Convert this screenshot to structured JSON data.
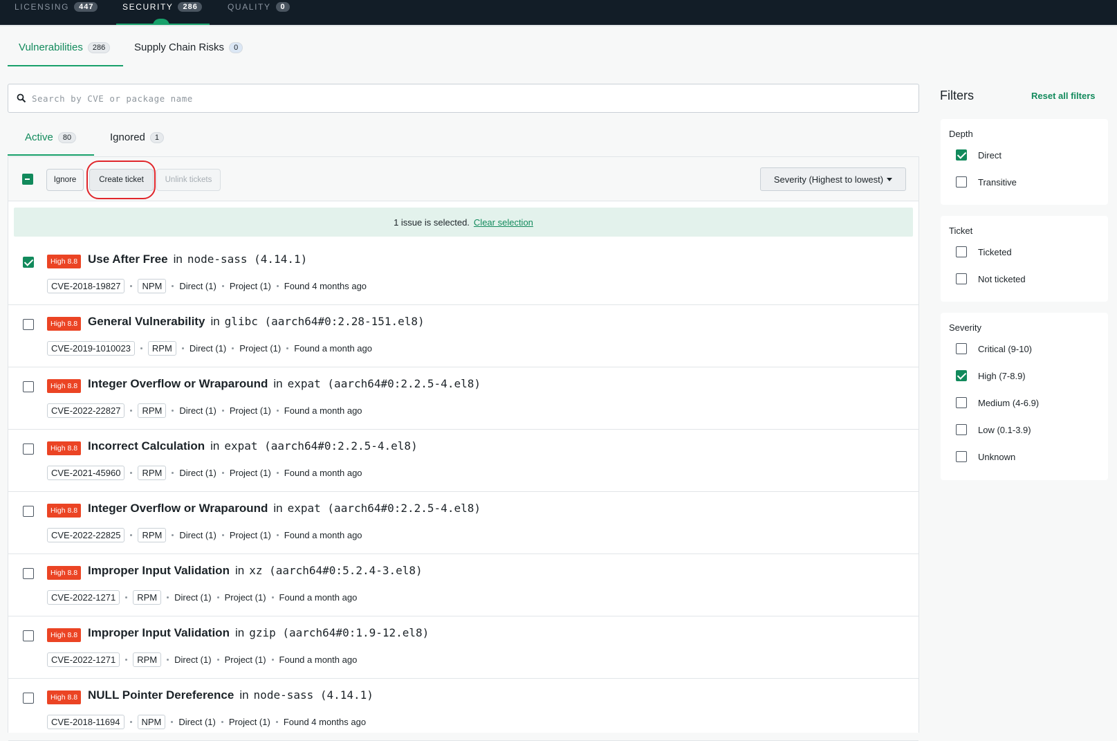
{
  "topnav": [
    {
      "label": "LICENSING",
      "count": "447",
      "active": false
    },
    {
      "label": "SECURITY",
      "count": "286",
      "active": true
    },
    {
      "label": "QUALITY",
      "count": "0",
      "active": false
    }
  ],
  "subtabs": [
    {
      "label": "Vulnerabilities",
      "count": "286",
      "active": true
    },
    {
      "label": "Supply Chain Risks",
      "count": "0",
      "active": false
    }
  ],
  "search": {
    "placeholder": "Search by CVE or package name",
    "value": ""
  },
  "state_tabs": [
    {
      "label": "Active",
      "count": "80",
      "active": true
    },
    {
      "label": "Ignored",
      "count": "1",
      "active": false
    }
  ],
  "toolbar": {
    "ignore_label": "Ignore",
    "create_ticket_label": "Create ticket",
    "unlink_tickets_label": "Unlink tickets",
    "sort_label": "Severity (Highest to lowest)"
  },
  "banner": {
    "text": "1 issue is selected.",
    "link": "Clear selection"
  },
  "vulnerabilities": [
    {
      "severity": "High 8.8",
      "title": "Use After Free",
      "in": "in",
      "package": "node-sass (4.14.1)",
      "cve": "CVE-2018-19827",
      "ecosystem": "NPM",
      "depth": "Direct (1)",
      "project": "Project (1)",
      "found": "Found 4 months ago",
      "checked": true
    },
    {
      "severity": "High 8.8",
      "title": "General Vulnerability",
      "in": "in",
      "package": "glibc (aarch64#0:2.28-151.el8)",
      "cve": "CVE-2019-1010023",
      "ecosystem": "RPM",
      "depth": "Direct (1)",
      "project": "Project (1)",
      "found": "Found a month ago",
      "checked": false
    },
    {
      "severity": "High 8.8",
      "title": "Integer Overflow or Wraparound",
      "in": "in",
      "package": "expat (aarch64#0:2.2.5-4.el8)",
      "cve": "CVE-2022-22827",
      "ecosystem": "RPM",
      "depth": "Direct (1)",
      "project": "Project (1)",
      "found": "Found a month ago",
      "checked": false
    },
    {
      "severity": "High 8.8",
      "title": "Incorrect Calculation",
      "in": "in",
      "package": "expat (aarch64#0:2.2.5-4.el8)",
      "cve": "CVE-2021-45960",
      "ecosystem": "RPM",
      "depth": "Direct (1)",
      "project": "Project (1)",
      "found": "Found a month ago",
      "checked": false
    },
    {
      "severity": "High 8.8",
      "title": "Integer Overflow or Wraparound",
      "in": "in",
      "package": "expat (aarch64#0:2.2.5-4.el8)",
      "cve": "CVE-2022-22825",
      "ecosystem": "RPM",
      "depth": "Direct (1)",
      "project": "Project (1)",
      "found": "Found a month ago",
      "checked": false
    },
    {
      "severity": "High 8.8",
      "title": "Improper Input Validation",
      "in": "in",
      "package": "xz (aarch64#0:5.2.4-3.el8)",
      "cve": "CVE-2022-1271",
      "ecosystem": "RPM",
      "depth": "Direct (1)",
      "project": "Project (1)",
      "found": "Found a month ago",
      "checked": false
    },
    {
      "severity": "High 8.8",
      "title": "Improper Input Validation",
      "in": "in",
      "package": "gzip (aarch64#0:1.9-12.el8)",
      "cve": "CVE-2022-1271",
      "ecosystem": "RPM",
      "depth": "Direct (1)",
      "project": "Project (1)",
      "found": "Found a month ago",
      "checked": false
    },
    {
      "severity": "High 8.8",
      "title": "NULL Pointer Dereference",
      "in": "in",
      "package": "node-sass (4.14.1)",
      "cve": "CVE-2018-11694",
      "ecosystem": "NPM",
      "depth": "Direct (1)",
      "project": "Project (1)",
      "found": "Found 4 months ago",
      "checked": false
    }
  ],
  "filters": {
    "title": "Filters",
    "reset_label": "Reset all filters",
    "groups": [
      {
        "title": "Depth",
        "options": [
          {
            "label": "Direct",
            "checked": true
          },
          {
            "label": "Transitive",
            "checked": false
          }
        ]
      },
      {
        "title": "Ticket",
        "options": [
          {
            "label": "Ticketed",
            "checked": false
          },
          {
            "label": "Not ticketed",
            "checked": false
          }
        ]
      },
      {
        "title": "Severity",
        "options": [
          {
            "label": "Critical (9-10)",
            "checked": false
          },
          {
            "label": "High (7-8.9)",
            "checked": true
          },
          {
            "label": "Medium (4-6.9)",
            "checked": false
          },
          {
            "label": "Low (0.1-3.9)",
            "checked": false
          },
          {
            "label": "Unknown",
            "checked": false
          }
        ]
      }
    ]
  },
  "colors": {
    "accent": "#128a5c",
    "severity_high": "#eb4424",
    "topbar": "#121d27",
    "annotation_ring": "#e0262b"
  }
}
